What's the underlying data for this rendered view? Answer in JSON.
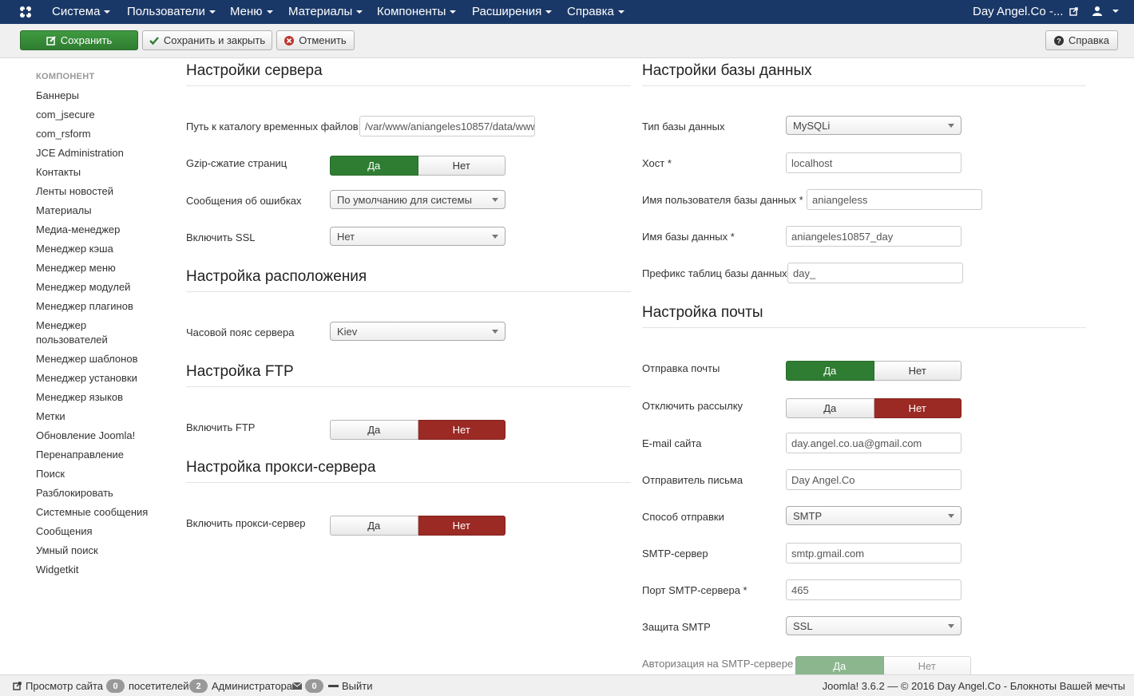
{
  "nav": {
    "menu": [
      "Система",
      "Пользователи",
      "Меню",
      "Материалы",
      "Компоненты",
      "Расширения",
      "Справка"
    ],
    "site_name": "Day Angel.Co -..."
  },
  "toolbar": {
    "save": "Сохранить",
    "save_close": "Сохранить и закрыть",
    "cancel": "Отменить",
    "help": "Справка"
  },
  "sidebar": {
    "heading": "КОМПОНЕНТ",
    "items": [
      "Баннеры",
      "com_jsecure",
      "com_rsform",
      "JCE Administration",
      "Контакты",
      "Ленты новостей",
      "Материалы",
      "Медиа-менеджер",
      "Менеджер кэша",
      "Менеджер меню",
      "Менеджер модулей",
      "Менеджер плагинов",
      "Менеджер пользователей",
      "Менеджер шаблонов",
      "Менеджер установки",
      "Менеджер языков",
      "Метки",
      "Обновление Joomla!",
      "Перенаправление",
      "Поиск",
      "Разблокировать",
      "Системные сообщения",
      "Сообщения",
      "Умный поиск",
      "Widgetkit"
    ]
  },
  "yes": "Да",
  "no": "Нет",
  "server": {
    "title": "Настройки сервера",
    "tmp_label": "Путь к каталогу временных файлов",
    "tmp_value": "/var/www/aniangeles10857/data/www",
    "gzip_label": "Gzip-сжатие страниц",
    "errors_label": "Сообщения об ошибках",
    "errors_value": "По умолчанию для системы",
    "ssl_label": "Включить SSL",
    "ssl_value": "Нет"
  },
  "locale": {
    "title": "Настройка расположения",
    "tz_label": "Часовой пояс сервера",
    "tz_value": "Kiev"
  },
  "ftp": {
    "title": "Настройка FTP",
    "enable_label": "Включить FTP"
  },
  "proxy": {
    "title": "Настройка прокси-сервера",
    "enable_label": "Включить прокси-сервер"
  },
  "database": {
    "title": "Настройки базы данных",
    "type_label": "Тип базы данных",
    "type_value": "MySQLi",
    "host_label": "Хост *",
    "host_value": "localhost",
    "user_label": "Имя пользователя базы данных *",
    "user_value": "aniangeless",
    "name_label": "Имя базы данных *",
    "name_value": "aniangeles10857_day",
    "prefix_label": "Префикс таблиц базы данных",
    "prefix_value": "day_"
  },
  "mail": {
    "title": "Настройка почты",
    "send_label": "Отправка почты",
    "disable_label": "Отключить рассылку",
    "email_label": "E-mail сайта",
    "email_value": "day.angel.co.ua@gmail.com",
    "from_label": "Отправитель письма",
    "from_value": "Day Angel.Co",
    "method_label": "Способ отправки",
    "method_value": "SMTP",
    "host_label": "SMTP-сервер",
    "host_value": "smtp.gmail.com",
    "port_label": "Порт SMTP-сервера *",
    "port_value": "465",
    "secure_label": "Защита SMTP",
    "secure_value": "SSL",
    "auth_label": "Авторизация на SMTP-сервере"
  },
  "status": {
    "view_site": "Просмотр сайта",
    "visitors_count": "0",
    "visitors": "посетителей",
    "admins_count": "2",
    "admins": "Администратора",
    "messages_count": "0",
    "logout": "Выйти",
    "footer": "Joomla! 3.6.2 — © 2016 Day Angel.Co - Блокноты Вашей мечты"
  }
}
